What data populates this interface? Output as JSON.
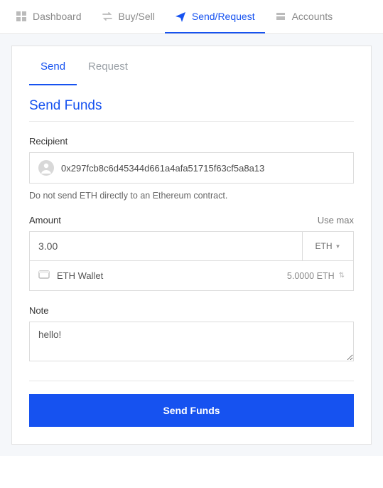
{
  "nav": {
    "dashboard": "Dashboard",
    "buysell": "Buy/Sell",
    "sendrequest": "Send/Request",
    "accounts": "Accounts"
  },
  "tabs": {
    "send": "Send",
    "request": "Request"
  },
  "section_title": "Send Funds",
  "recipient": {
    "label": "Recipient",
    "value": "0x297fcb8c6d45344d661a4afa51715f63cf5a8a13",
    "helper": "Do not send ETH directly to an Ethereum contract."
  },
  "amount": {
    "label": "Amount",
    "use_max": "Use max",
    "value": "3.00",
    "currency": "ETH",
    "wallet_name": "ETH Wallet",
    "wallet_balance": "5.0000 ETH"
  },
  "note": {
    "label": "Note",
    "value": "hello!"
  },
  "submit_label": "Send Funds"
}
